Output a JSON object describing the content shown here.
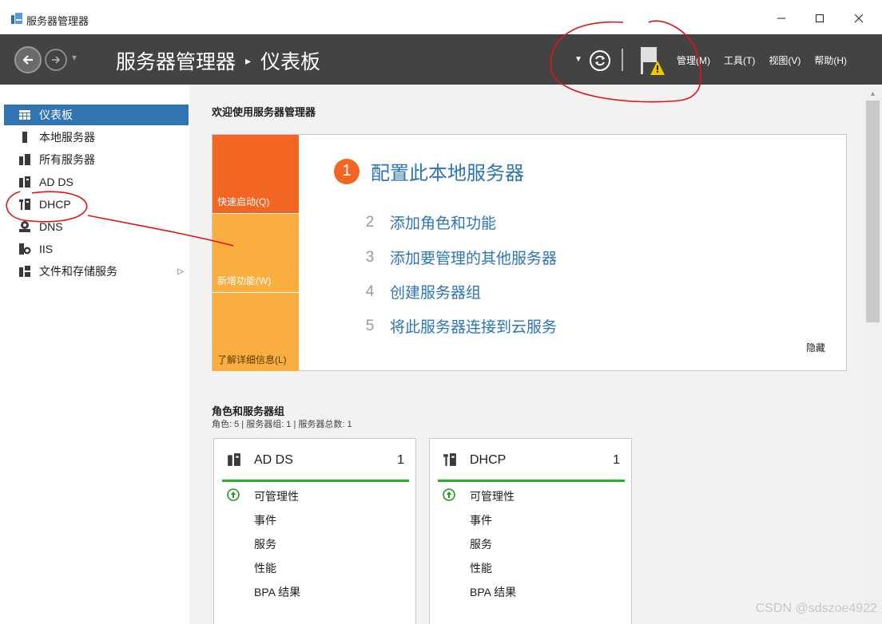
{
  "window": {
    "title": "服务器管理器",
    "controls": [
      "minimize",
      "maximize",
      "close"
    ]
  },
  "header": {
    "breadcrumb_root": "服务器管理器",
    "breadcrumb_separator": "▸",
    "breadcrumb_current": "仪表板",
    "menus": [
      "管理(M)",
      "工具(T)",
      "视图(V)",
      "帮助(H)"
    ]
  },
  "sidebar": {
    "items": [
      {
        "label": "仪表板",
        "icon": "dashboard-icon",
        "active": true
      },
      {
        "label": "本地服务器",
        "icon": "server-icon"
      },
      {
        "label": "所有服务器",
        "icon": "servers-icon"
      },
      {
        "label": "AD DS",
        "icon": "adds-icon"
      },
      {
        "label": "DHCP",
        "icon": "dhcp-icon"
      },
      {
        "label": "DNS",
        "icon": "dns-icon"
      },
      {
        "label": "IIS",
        "icon": "iis-icon"
      },
      {
        "label": "文件和存储服务",
        "icon": "storage-icon",
        "expand": "▷"
      }
    ]
  },
  "main": {
    "welcome": "欢迎使用服务器管理器",
    "quick_start": {
      "tiles": [
        "快速启动(Q)",
        "新增功能(W)",
        "了解详细信息(L)"
      ],
      "step1": {
        "num": "1",
        "label": "配置此本地服务器"
      },
      "steps": [
        {
          "num": "2",
          "label": "添加角色和功能"
        },
        {
          "num": "3",
          "label": "添加要管理的其他服务器"
        },
        {
          "num": "4",
          "label": "创建服务器组"
        },
        {
          "num": "5",
          "label": "将此服务器连接到云服务"
        }
      ],
      "hide": "隐藏"
    },
    "roles": {
      "title": "角色和服务器组",
      "subtitle": "角色: 5 | 服务器组: 1 | 服务器总数: 1",
      "cards": [
        {
          "title": "AD DS",
          "count": "1",
          "rows": [
            "可管理性",
            "事件",
            "服务",
            "性能",
            "BPA 结果"
          ]
        },
        {
          "title": "DHCP",
          "count": "1",
          "rows": [
            "可管理性",
            "事件",
            "服务",
            "性能",
            "BPA 结果"
          ]
        }
      ]
    }
  },
  "watermark": "CSDN @sdszoe4922",
  "colors": {
    "header_bg": "#434343",
    "active_item": "#3275b3",
    "tile_dark_orange": "#f26522",
    "tile_orange": "#fbae40",
    "link_blue": "#2e75b6",
    "status_green": "#28b028"
  }
}
